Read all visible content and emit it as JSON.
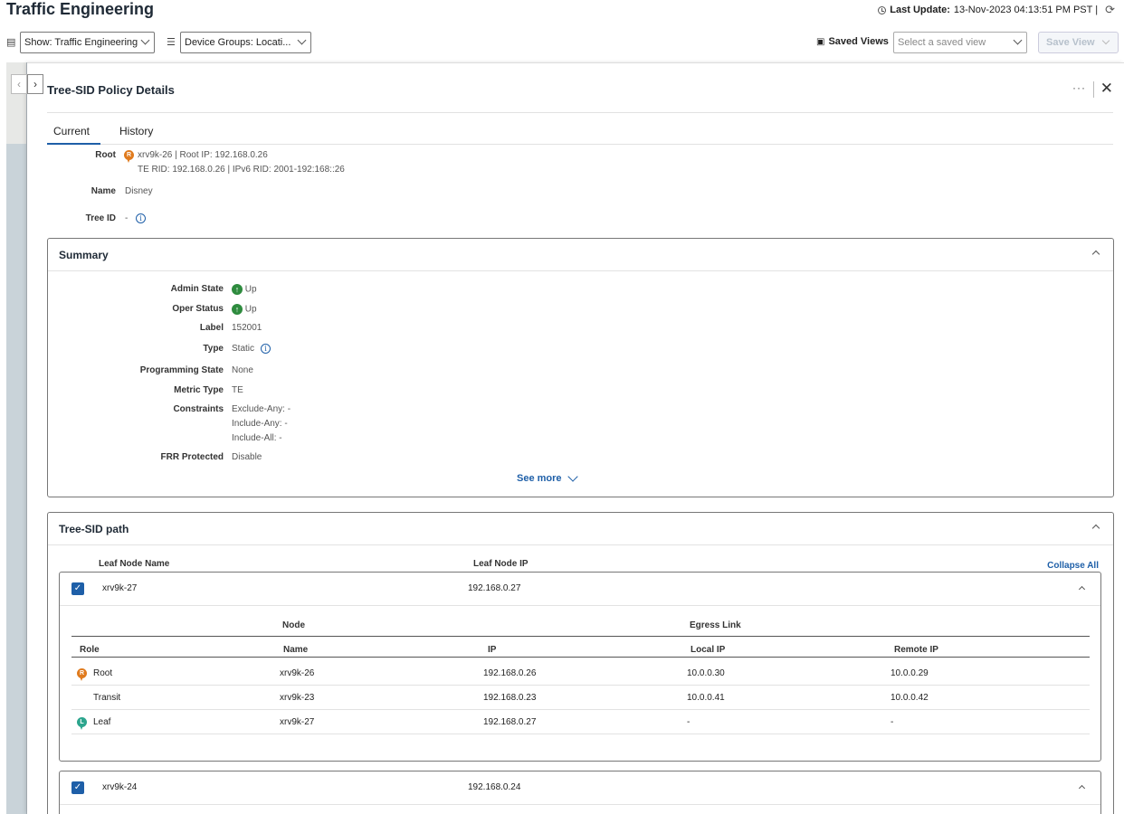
{
  "header": {
    "title": "Traffic Engineering",
    "last_update_label": "Last Update:",
    "last_update_value": "13-Nov-2023 04:13:51 PM PST |"
  },
  "filters": {
    "show": "Show: Traffic Engineering",
    "device_groups": "Device Groups: Locati...",
    "saved_views_label": "Saved Views",
    "saved_view_placeholder": "Select a saved view",
    "save_view_button": "Save View"
  },
  "panel": {
    "title": "Tree-SID Policy Details",
    "tabs": [
      "Current",
      "History"
    ],
    "root_label": "Root",
    "root_badge": "R",
    "root_line1": "xrv9k-26 | Root IP: 192.168.0.26",
    "root_line2": "TE RID: 192.168.0.26 | IPv6 RID: 2001-192:168::26",
    "name_label": "Name",
    "name_value": "Disney",
    "tree_id_label": "Tree ID",
    "tree_id_value": "-"
  },
  "summary": {
    "title": "Summary",
    "fields": [
      {
        "label": "Admin State",
        "value": "Up"
      },
      {
        "label": "Oper Status",
        "value": "Up"
      },
      {
        "label": "Label",
        "value": "152001"
      },
      {
        "label": "Type",
        "value": "Static"
      },
      {
        "label": "Programming State",
        "value": "None"
      },
      {
        "label": "Metric Type",
        "value": "TE"
      },
      {
        "label": "Constraints",
        "value": "Exclude-Any: -"
      },
      {
        "label": "",
        "value": "Include-Any: -"
      },
      {
        "label": "",
        "value": "Include-All: -"
      },
      {
        "label": "FRR Protected",
        "value": "Disable"
      }
    ],
    "see_more": "See more"
  },
  "path": {
    "title": "Tree-SID path",
    "col_leaf_name": "Leaf Node Name",
    "col_leaf_ip": "Leaf Node IP",
    "collapse_all": "Collapse All",
    "leaves": [
      {
        "name": "xrv9k-27",
        "ip": "192.168.0.27"
      },
      {
        "name": "xrv9k-24",
        "ip": "192.168.0.24"
      }
    ],
    "group_node": "Node",
    "group_egress": "Egress Link",
    "columns": [
      "Role",
      "Name",
      "IP",
      "Local IP",
      "Remote IP"
    ],
    "rows": [
      {
        "role": "Root",
        "badge": "R",
        "name": "xrv9k-26",
        "ip": "192.168.0.26",
        "local": "10.0.0.30",
        "remote": "10.0.0.29"
      },
      {
        "role": "Transit",
        "badge": "",
        "name": "xrv9k-23",
        "ip": "192.168.0.23",
        "local": "10.0.0.41",
        "remote": "10.0.0.42"
      },
      {
        "role": "Leaf",
        "badge": "L",
        "name": "xrv9k-27",
        "ip": "192.168.0.27",
        "local": "-",
        "remote": "-"
      }
    ]
  }
}
